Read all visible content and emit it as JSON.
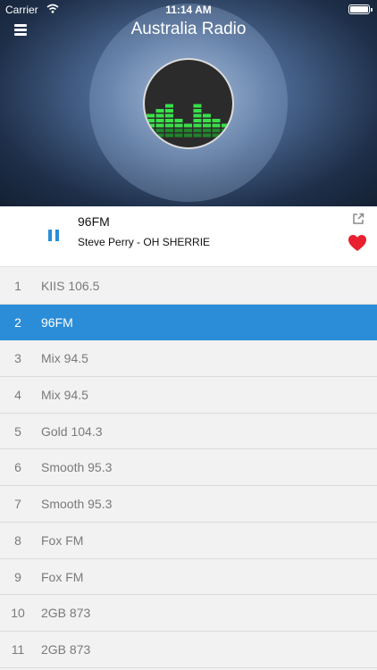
{
  "status_bar": {
    "carrier": "Carrier",
    "time": "11:14 AM"
  },
  "header": {
    "title": "Australia Radio",
    "menu_icon": "hamburger-menu-icon",
    "artwork_icon": "equalizer-bars-icon"
  },
  "now_playing": {
    "station": "96FM",
    "track": "Steve Perry - OH SHERRIE",
    "state": "playing",
    "favorite": true
  },
  "stations": [
    {
      "number": "1",
      "name": "KIIS 106.5",
      "active": false
    },
    {
      "number": "2",
      "name": "96FM",
      "active": true
    },
    {
      "number": "3",
      "name": "Mix 94.5",
      "active": false
    },
    {
      "number": "4",
      "name": "Mix 94.5",
      "active": false
    },
    {
      "number": "5",
      "name": "Gold 104.3",
      "active": false
    },
    {
      "number": "6",
      "name": "Smooth 95.3",
      "active": false
    },
    {
      "number": "7",
      "name": "Smooth 95.3",
      "active": false
    },
    {
      "number": "8",
      "name": "Fox FM",
      "active": false
    },
    {
      "number": "9",
      "name": "Fox FM",
      "active": false
    },
    {
      "number": "10",
      "name": "2GB 873",
      "active": false
    },
    {
      "number": "11",
      "name": "2GB 873",
      "active": false
    }
  ],
  "colors": {
    "accent": "#2b8dd8",
    "favorite": "#e8202f",
    "equalizer": "#39e04a"
  }
}
